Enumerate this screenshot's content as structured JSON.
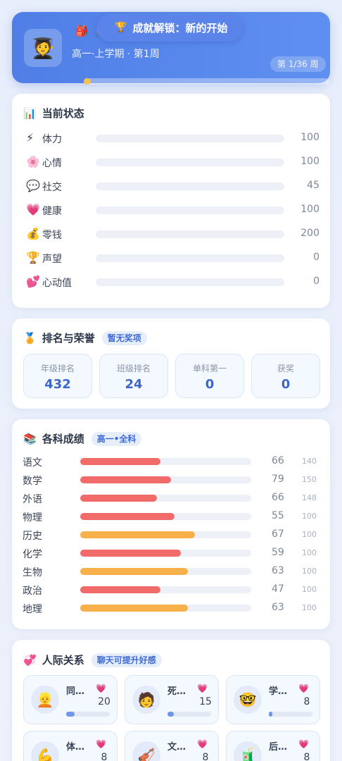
{
  "header": {
    "avatar_emoji": "🧑‍🎓",
    "decor_icons": "🎒 🚶",
    "toast_icon": "🏆",
    "toast_text": "成就解锁：新的开始",
    "subtitle": "高一·上学期 · 第1周",
    "week_label": "第 1/36 周",
    "progress_fraction": 0.028,
    "accent_color": "#5a8aee"
  },
  "status": {
    "icon": "📊",
    "title": "当前状态",
    "items": [
      {
        "icon": "⚡",
        "label": "体力",
        "value": "100",
        "fraction": 0
      },
      {
        "icon": "🌸",
        "label": "心情",
        "value": "100",
        "fraction": 0
      },
      {
        "icon": "💬",
        "label": "社交",
        "value": "45",
        "fraction": 0
      },
      {
        "icon": "💗",
        "label": "健康",
        "value": "100",
        "fraction": 0
      },
      {
        "icon": "💰",
        "label": "零钱",
        "value": "200",
        "fraction": 0
      },
      {
        "icon": "🏆",
        "label": "声望",
        "value": "0",
        "fraction": 0
      },
      {
        "icon": "💕",
        "label": "心动值",
        "value": "0",
        "fraction": 0
      }
    ]
  },
  "honors": {
    "icon": "🏅",
    "title": "排名与荣誉",
    "tag": "暂无奖项",
    "items": [
      {
        "label": "年级排名",
        "value": "432"
      },
      {
        "label": "班级排名",
        "value": "24"
      },
      {
        "label": "单科第一",
        "value": "0"
      },
      {
        "label": "获奖",
        "value": "0"
      }
    ]
  },
  "grades": {
    "icon": "📚",
    "title": "各科成绩",
    "tag": "高一•全科",
    "colors": {
      "low": "#f26b6b",
      "mid": "#f8b04a"
    },
    "items": [
      {
        "subject": "语文",
        "score": "66",
        "max": "140",
        "fraction": 0.47,
        "level": "low"
      },
      {
        "subject": "数学",
        "score": "79",
        "max": "150",
        "fraction": 0.53,
        "level": "low"
      },
      {
        "subject": "外语",
        "score": "66",
        "max": "148",
        "fraction": 0.45,
        "level": "low"
      },
      {
        "subject": "物理",
        "score": "55",
        "max": "100",
        "fraction": 0.55,
        "level": "low"
      },
      {
        "subject": "历史",
        "score": "67",
        "max": "100",
        "fraction": 0.67,
        "level": "mid"
      },
      {
        "subject": "化学",
        "score": "59",
        "max": "100",
        "fraction": 0.59,
        "level": "low"
      },
      {
        "subject": "生物",
        "score": "63",
        "max": "100",
        "fraction": 0.63,
        "level": "mid"
      },
      {
        "subject": "政治",
        "score": "47",
        "max": "100",
        "fraction": 0.47,
        "level": "low"
      },
      {
        "subject": "地理",
        "score": "63",
        "max": "100",
        "fraction": 0.63,
        "level": "mid"
      }
    ]
  },
  "relations": {
    "icon": "💞",
    "title": "人际关系",
    "tag": "聊天可提升好感",
    "items": [
      {
        "avatar": "👱",
        "name": "同…",
        "points": "20",
        "fraction": 0.2
      },
      {
        "avatar": "🧑",
        "name": "死…",
        "points": "15",
        "fraction": 0.15
      },
      {
        "avatar": "🤓",
        "name": "学…",
        "points": "8",
        "fraction": 0.08
      },
      {
        "avatar": "💪",
        "name": "体…",
        "points": "8",
        "fraction": 0.08
      },
      {
        "avatar": "🎻",
        "name": "文…",
        "points": "8",
        "fraction": 0.08
      },
      {
        "avatar": "🧃",
        "name": "后…",
        "points": "8",
        "fraction": 0.08
      }
    ]
  }
}
